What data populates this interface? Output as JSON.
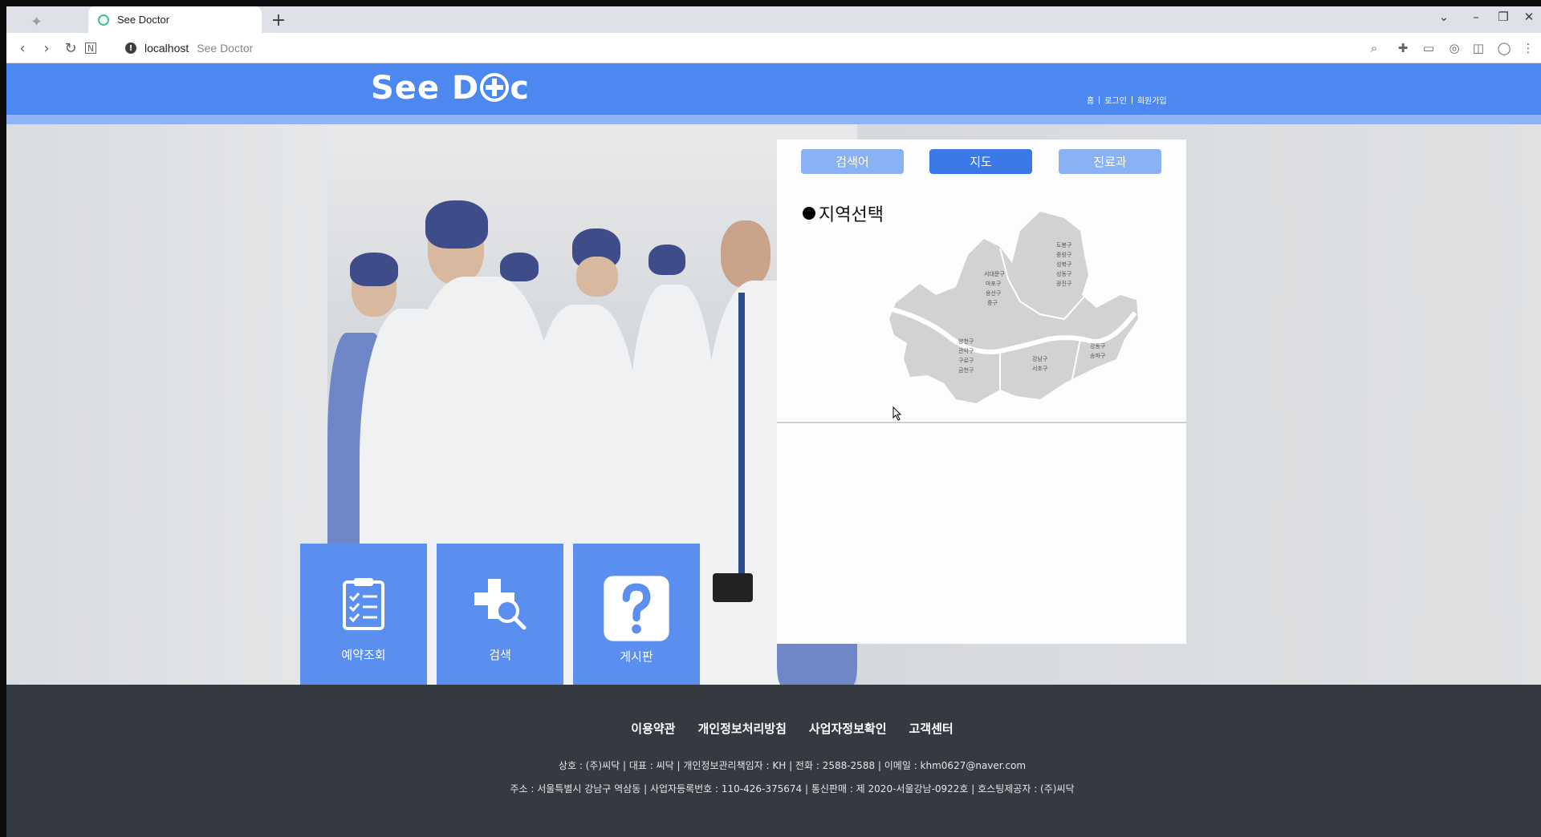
{
  "browser": {
    "tab_title": "See Doctor",
    "new_tab_label": "+",
    "url_host": "localhost",
    "url_page_title": "See Doctor"
  },
  "header": {
    "logo_text_left": "See D",
    "logo_text_right": "c",
    "nav": [
      "홈",
      "로그인",
      "회원가입"
    ]
  },
  "tiles": [
    {
      "label": "예약조회",
      "icon": "clipboard-checklist-icon"
    },
    {
      "label": "검색",
      "icon": "medical-search-icon"
    },
    {
      "label": "게시판",
      "icon": "question-mark-icon"
    }
  ],
  "panel": {
    "tabs": [
      {
        "label": "검색어",
        "active": false
      },
      {
        "label": "지도",
        "active": true
      },
      {
        "label": "진료과",
        "active": false
      }
    ],
    "region_title": "지역선택",
    "map_regions": [
      {
        "lines": [
          "도봉구",
          "중랑구",
          "성북구",
          "성동구",
          "광진구"
        ]
      },
      {
        "lines": [
          "서대문구",
          "마포구",
          "용산구",
          "중구"
        ]
      },
      {
        "lines": [
          "양천구",
          "관악구",
          "구로구",
          "금천구"
        ]
      },
      {
        "lines": [
          "강남구",
          "서초구"
        ]
      },
      {
        "lines": [
          "강동구",
          "송파구"
        ]
      }
    ]
  },
  "footer": {
    "links": [
      "이용약관",
      "개인정보처리방침",
      "사업자정보확인",
      "고객센터"
    ],
    "line1": "상호 : (주)씨닥 | 대표 : 씨닥 | 개인정보관리책임자 : KH | 전화 : 2588-2588 | 이메일 : khm0627@naver.com",
    "line2": "주소 : 서울특별시 강남구 역삼동 | 사업자등록번호 : 110-426-375674 | 통신판매 : 제 2020-서울강남-0922호 | 호스팅제공자 : (주)씨닥"
  },
  "colors": {
    "header_blue": "#4d88f0",
    "tile_blue": "#5a8ff0",
    "tab_active": "#3b78e8",
    "tab_inactive": "#8ab1f4",
    "footer_bg": "#343a40"
  }
}
